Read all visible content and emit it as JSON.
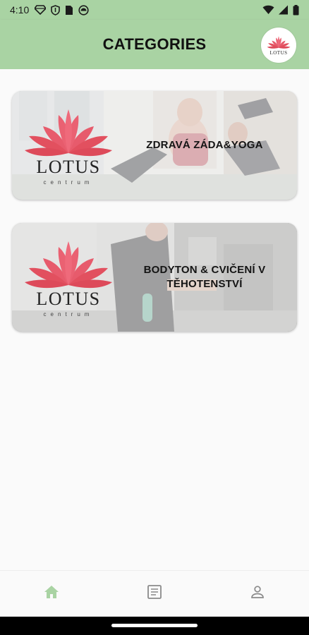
{
  "status_bar": {
    "time": "4:10",
    "left_icons": [
      "diamond-icon",
      "shield-icon",
      "sim-card-icon",
      "circle-app-icon"
    ],
    "right_icons": [
      "wifi-icon",
      "signal-icon",
      "battery-icon"
    ]
  },
  "app_bar": {
    "title": "CATEGORIES",
    "logo_text": "LOTUS",
    "background": "#a9d3a3"
  },
  "categories": [
    {
      "title": "ZDRAVÁ ZÁDA&YOGA",
      "logo_word": "LOTUS",
      "logo_sub": "centrum"
    },
    {
      "title": "BODYTON & CVIČENÍ V TĚHOTENSTVÍ",
      "logo_word": "LOTUS",
      "logo_sub": "centrum"
    }
  ],
  "bottom_nav": {
    "items": [
      {
        "icon": "home-icon",
        "active": true
      },
      {
        "icon": "document-icon",
        "active": false
      },
      {
        "icon": "person-icon",
        "active": false
      }
    ],
    "active_color": "#a9d3a3",
    "inactive_color": "#8a8a8a"
  },
  "colors": {
    "accent_green": "#a9d3a3",
    "lotus_pink": "#e8586a"
  }
}
